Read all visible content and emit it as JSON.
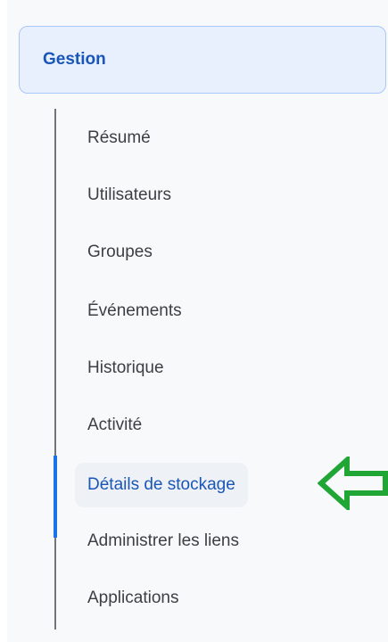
{
  "section": {
    "title": "Gestion"
  },
  "nav": {
    "items": [
      {
        "label": "Résumé"
      },
      {
        "label": "Utilisateurs"
      },
      {
        "label": "Groupes"
      },
      {
        "label": "Événements"
      },
      {
        "label": "Historique"
      },
      {
        "label": "Activité"
      },
      {
        "label": "Détails de stockage",
        "active": true
      },
      {
        "label": "Administrer les liens"
      },
      {
        "label": "Applications"
      }
    ]
  },
  "annotation": {
    "icon": "arrow-left-outline-icon",
    "color": "#1fa635"
  },
  "colors": {
    "accent": "#1a56b8",
    "header_background": "#e8f0fe",
    "header_border": "#a8c7fa",
    "text": "#3c4043"
  }
}
